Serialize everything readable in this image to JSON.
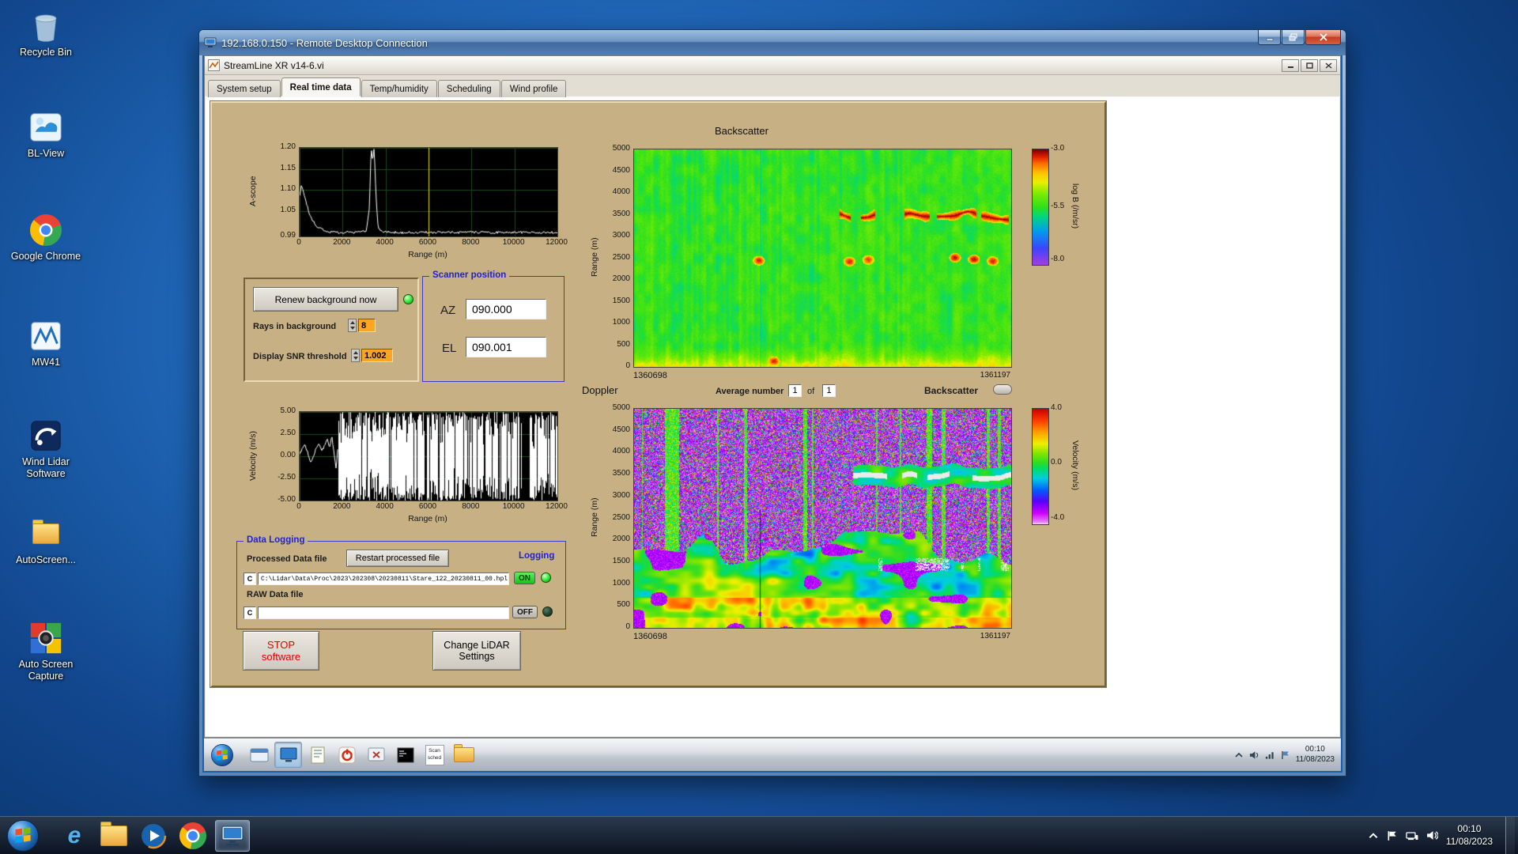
{
  "host": {
    "desktop_icons": [
      {
        "label": "Recycle Bin"
      },
      {
        "label": "BL-View"
      },
      {
        "label": "Google Chrome"
      },
      {
        "label": "MW41"
      },
      {
        "label": "Wind Lidar Software"
      },
      {
        "label": "AutoScreen..."
      },
      {
        "label": "Auto Screen Capture"
      }
    ],
    "taskbar": {
      "clock_time": "00:10",
      "clock_date": "11/08/2023"
    }
  },
  "rdp": {
    "title": "192.168.0.150 - Remote Desktop Connection",
    "taskbar": {
      "clock_time": "00:10",
      "clock_date": "11/08/2023",
      "scan_icon_line1": "Scan",
      "scan_icon_line2": "sched"
    }
  },
  "app": {
    "title": "StreamLine XR v14-6.vi",
    "tabs": [
      {
        "label": "System setup"
      },
      {
        "label": "Real time data"
      },
      {
        "label": "Temp/humidity"
      },
      {
        "label": "Scheduling"
      },
      {
        "label": "Wind profile"
      }
    ],
    "active_tab": "Real time data",
    "background_group": {
      "renew_button": "Renew background now",
      "rays_label": "Rays in background",
      "rays_value": "8",
      "snr_label": "Display SNR threshold",
      "snr_value": "1.002"
    },
    "scanner": {
      "title": "Scanner position",
      "az_label": "AZ",
      "az_value": "090.000",
      "el_label": "EL",
      "el_value": "090.001"
    },
    "doppler_bar": {
      "average_label": "Average number",
      "average_value": "1",
      "of_label": "of",
      "average_total": "1",
      "backscatter_toggle_label": "Backscatter"
    },
    "data_logging": {
      "title": "Data Logging",
      "processed_label": "Processed Data file",
      "restart_button": "Restart processed file",
      "logging_label": "Logging",
      "drive_letter": "C",
      "processed_path": "C:\\Lidar\\Data\\Proc\\2023\\202308\\20230811\\Stare_122_20230811_00.hpl",
      "on_label": "ON",
      "raw_label": "RAW Data file",
      "raw_path": "",
      "off_label": "OFF"
    },
    "stop_button_line1": "STOP",
    "stop_button_line2": "software",
    "change_button_line1": "Change LiDAR",
    "change_button_line2": "Settings"
  },
  "chart_data": [
    {
      "id": "ascope",
      "type": "line",
      "xlabel": "Range (m)",
      "ylabel": "A-scope",
      "xlim": [
        0,
        12000
      ],
      "ylim": [
        0.99,
        1.2
      ],
      "xticks": [
        "0",
        "2000",
        "4000",
        "6000",
        "8000",
        "10000",
        "12000"
      ],
      "yticks": [
        "1.20",
        "1.15",
        "1.10",
        "1.05",
        "0.99"
      ],
      "cursor_x": 6000,
      "line_color": "#ffffff",
      "jitter": 0.006,
      "points": [
        [
          0,
          1.085
        ],
        [
          80,
          1.112
        ],
        [
          160,
          1.1
        ],
        [
          300,
          1.07
        ],
        [
          450,
          1.045
        ],
        [
          600,
          1.028
        ],
        [
          800,
          1.014
        ],
        [
          1000,
          1.007
        ],
        [
          1300,
          1.002
        ],
        [
          1600,
          1.0
        ],
        [
          2000,
          0.999
        ],
        [
          2400,
          1.0
        ],
        [
          2800,
          1.0
        ],
        [
          3100,
          1.003
        ],
        [
          3250,
          1.06
        ],
        [
          3330,
          1.2
        ],
        [
          3400,
          1.17
        ],
        [
          3470,
          1.2
        ],
        [
          3560,
          1.08
        ],
        [
          3660,
          1.01
        ],
        [
          3800,
          1.002
        ],
        [
          4200,
          1.0
        ],
        [
          5000,
          0.999
        ],
        [
          6000,
          1.0
        ],
        [
          7000,
          0.999
        ],
        [
          8000,
          1.0
        ],
        [
          9000,
          0.999
        ],
        [
          10000,
          1.0
        ],
        [
          11000,
          0.999
        ],
        [
          12000,
          1.0
        ]
      ]
    },
    {
      "id": "velocity",
      "type": "line",
      "xlabel": "Range (m)",
      "ylabel": "Velocity (m/s)",
      "xlim": [
        0,
        12000
      ],
      "ylim": [
        -5,
        5
      ],
      "xticks": [
        "0",
        "2000",
        "4000",
        "6000",
        "8000",
        "10000",
        "12000"
      ],
      "yticks": [
        "5.00",
        "2.50",
        "0.00",
        "-2.50",
        "-5.00"
      ],
      "line_color": "#ffffff",
      "jitter": 0.3,
      "points": [
        [
          0,
          0.2
        ],
        [
          120,
          0.9
        ],
        [
          250,
          1.3
        ],
        [
          380,
          0.4
        ],
        [
          500,
          -0.6
        ],
        [
          620,
          -0.2
        ],
        [
          760,
          0.8
        ],
        [
          900,
          1.4
        ],
        [
          1020,
          0.7
        ],
        [
          1150,
          1.1
        ],
        [
          1280,
          1.9
        ],
        [
          1400,
          1.0
        ],
        [
          1500,
          2.2
        ],
        [
          1600,
          0.3
        ],
        [
          1700,
          -1.5
        ],
        [
          1780,
          1.2
        ]
      ],
      "noise_region": {
        "x_start": 1800,
        "x_end": 12000,
        "y_min": -5,
        "y_max": 5
      }
    },
    {
      "id": "backscatter",
      "type": "heatmap",
      "title": "Backscatter",
      "ylabel": "Range (m)",
      "ylim": [
        0,
        5000
      ],
      "yticks": [
        "5000",
        "4500",
        "4000",
        "3500",
        "3000",
        "2500",
        "2000",
        "1500",
        "1000",
        "500",
        "0"
      ],
      "x_start_label": "1360698",
      "x_end_label": "1361197",
      "colorbar": {
        "label": "log B (/m/sr)",
        "min": -8,
        "max": -3,
        "ticks": [
          "-3.0",
          "-5.5",
          "-8.0"
        ],
        "tick_fracs": [
          0,
          0.5,
          0.96
        ],
        "stops": [
          [
            0,
            165,
            60,
            230
          ],
          [
            0.15,
            60,
            70,
            255
          ],
          [
            0.3,
            0,
            160,
            235
          ],
          [
            0.42,
            0,
            215,
            130
          ],
          [
            0.5,
            45,
            225,
            30
          ],
          [
            0.62,
            125,
            235,
            0
          ],
          [
            0.72,
            235,
            240,
            0
          ],
          [
            0.8,
            255,
            195,
            0
          ],
          [
            0.88,
            255,
            110,
            0
          ],
          [
            0.94,
            225,
            30,
            0
          ],
          [
            1,
            125,
            0,
            0
          ]
        ]
      },
      "features": {
        "background_value": -5.45,
        "surface_band": {
          "range_max": 520,
          "value": -4.3
        },
        "cloud_layer": {
          "range": 3480,
          "t_start": 0.545,
          "value": -3.05,
          "thickness": 150
        },
        "dark_column_t": 0.334,
        "patches": [
          {
            "t": 0.33,
            "range": 2450,
            "value": -3.3
          },
          {
            "t": 0.57,
            "range": 2430,
            "value": -3.3
          },
          {
            "t": 0.62,
            "range": 2470,
            "value": -3.4
          },
          {
            "t": 0.85,
            "range": 2520,
            "value": -3.2
          },
          {
            "t": 0.9,
            "range": 2480,
            "value": -3.2
          },
          {
            "t": 0.95,
            "range": 2440,
            "value": -3.3
          },
          {
            "t": 0.37,
            "range": 140,
            "value": -3.3
          }
        ]
      }
    },
    {
      "id": "doppler",
      "type": "heatmap",
      "title": "Doppler",
      "ylabel": "Range (m)",
      "ylim": [
        0,
        5000
      ],
      "yticks": [
        "5000",
        "4500",
        "4000",
        "3500",
        "3000",
        "2500",
        "2000",
        "1500",
        "1000",
        "500",
        "0"
      ],
      "x_start_label": "1360698",
      "x_end_label": "1361197",
      "colorbar": {
        "label": "Velocity (m/s)",
        "min": -4,
        "max": 4,
        "ticks": [
          "4.0",
          "0.0",
          "-4.0"
        ],
        "tick_fracs": [
          0,
          0.47,
          0.95
        ],
        "stops": [
          [
            0,
            250,
            250,
            250
          ],
          [
            0.02,
            235,
            130,
            255
          ],
          [
            0.1,
            205,
            0,
            255
          ],
          [
            0.2,
            90,
            0,
            255
          ],
          [
            0.3,
            0,
            95,
            255
          ],
          [
            0.4,
            0,
            205,
            225
          ],
          [
            0.48,
            0,
            220,
            110
          ],
          [
            0.53,
            40,
            220,
            40
          ],
          [
            0.62,
            135,
            230,
            0
          ],
          [
            0.7,
            240,
            240,
            0
          ],
          [
            0.8,
            255,
            160,
            0
          ],
          [
            0.9,
            255,
            60,
            0
          ],
          [
            1,
            205,
            0,
            0
          ]
        ]
      },
      "features": {
        "noise_above_range": 1850,
        "cloud_band": {
          "range": 3480,
          "t_start": 0.58
        },
        "white_streak": {
          "range": 1450,
          "t_start": 0.6
        },
        "dark_column_t": 0.333,
        "bottom_warm_range": 700
      }
    }
  ]
}
